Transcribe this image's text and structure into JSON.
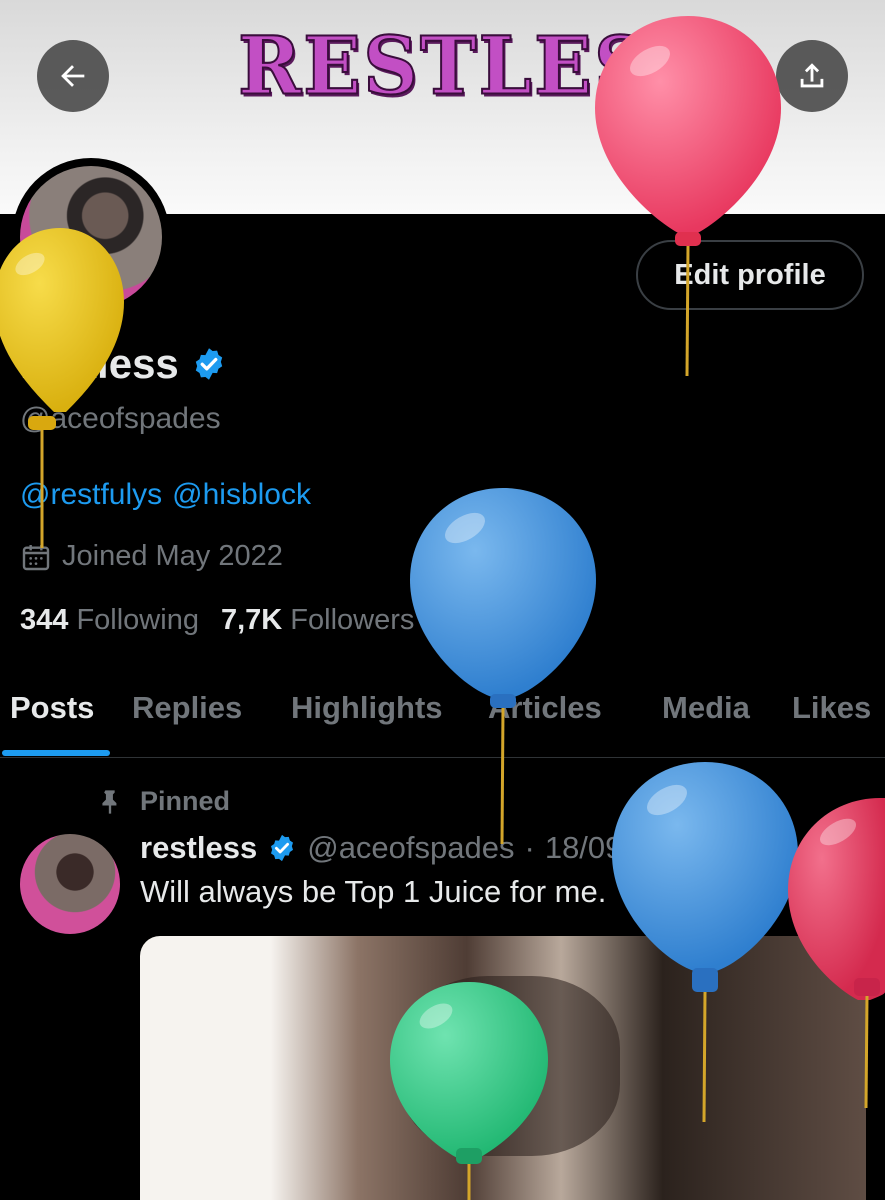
{
  "banner": {
    "title": "RESTLESS",
    "back_icon": "arrow-left-icon",
    "search_icon": "search-icon",
    "share_icon": "share-upload-icon"
  },
  "profile": {
    "edit_button": "Edit profile",
    "display_name": "restless",
    "handle": "@aceofspades",
    "bio_links": [
      "@restfulys",
      "@hisblock"
    ],
    "joined": "Joined May 2022",
    "following_count": "344",
    "following_label": "Following",
    "followers_count": "7,7K",
    "followers_label": "Followers"
  },
  "tabs": [
    "Posts",
    "Replies",
    "Highlights",
    "Articles",
    "Media",
    "Likes"
  ],
  "active_tab": "Posts",
  "post": {
    "pinned_label": "Pinned",
    "author_name": "restless",
    "author_handle": "@aceofspades",
    "separator": "·",
    "date": "18/09/2024",
    "text": "Will always be Top 1 Juice for me.",
    "more": "···"
  },
  "balloons": [
    "pink",
    "yellow",
    "blue",
    "blue",
    "red",
    "green"
  ],
  "colors": {
    "accent": "#1d9bf0",
    "background": "#000000",
    "text_primary": "#e7e9ea",
    "text_secondary": "#71767b",
    "verified": "#1d9bf0",
    "balloon_pink": "#f0557a",
    "balloon_yellow": "#e6c21a",
    "balloon_blue": "#3d8fd8",
    "balloon_red": "#e03357",
    "balloon_green": "#2fc986"
  }
}
